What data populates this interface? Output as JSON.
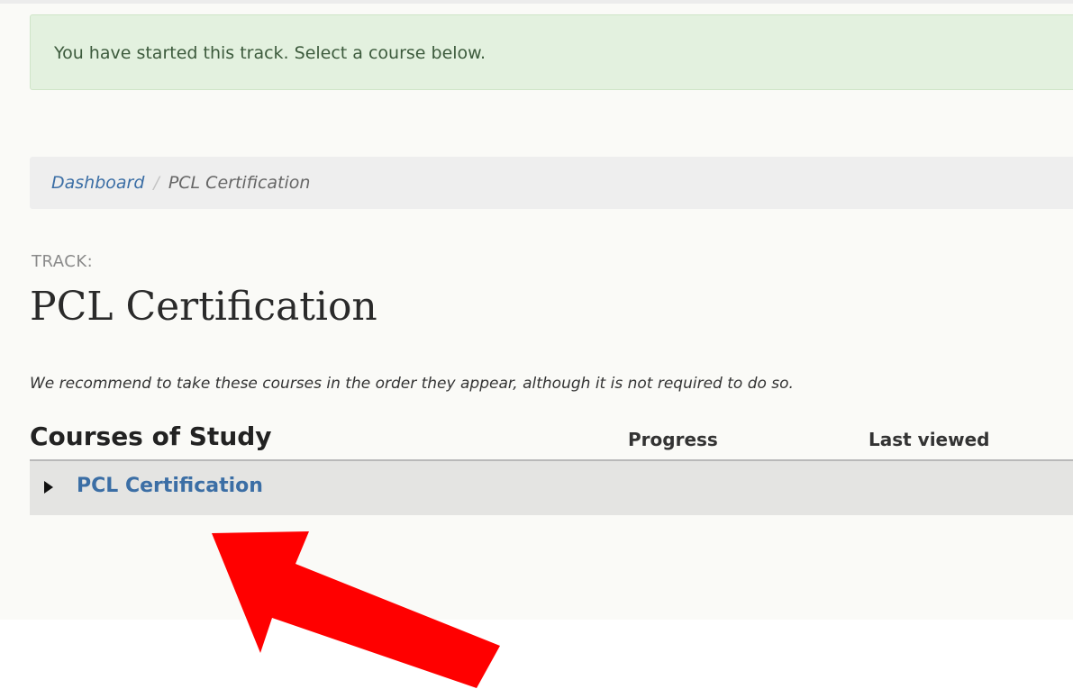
{
  "alert": {
    "message": "You have started this track. Select a course below."
  },
  "breadcrumb": {
    "items": [
      {
        "label": "Dashboard"
      },
      {
        "label": "PCL Certification"
      }
    ],
    "separator": "/"
  },
  "track": {
    "label": "TRACK:",
    "title": "PCL Certification",
    "note": "We recommend to take these courses in the order they appear, although it is not required to do so."
  },
  "courses": {
    "heading": "Courses of Study",
    "columns": {
      "progress": "Progress",
      "last_viewed": "Last viewed"
    },
    "rows": [
      {
        "title": "PCL Certification",
        "icon": "caret-right-icon"
      }
    ]
  },
  "colors": {
    "alert_bg": "#e3f1df",
    "link": "#3b6ea5",
    "arrow": "#ff0000"
  }
}
